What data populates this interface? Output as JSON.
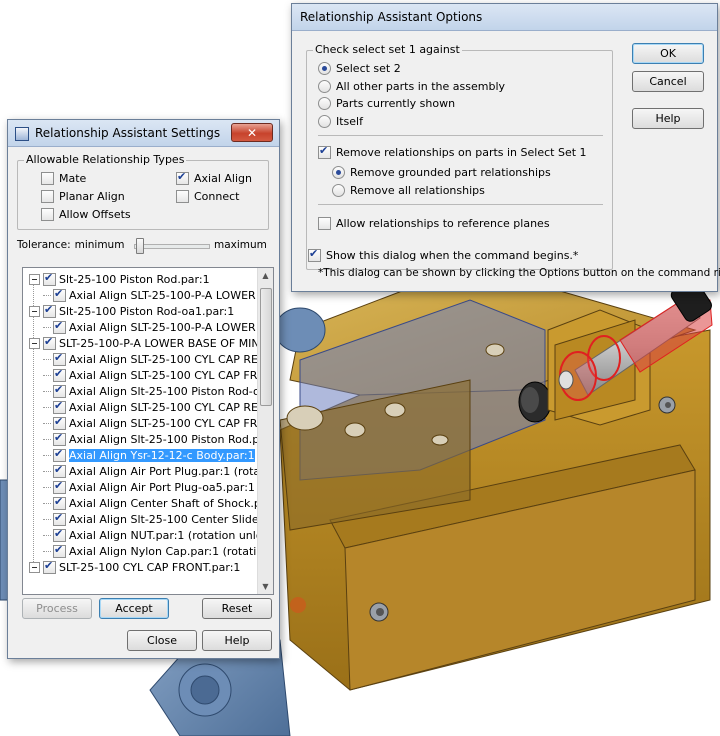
{
  "settings_dialog": {
    "title": "Relationship Assistant Settings",
    "close_glyph": "✕",
    "types_group_label": "Allowable Relationship Types",
    "types": [
      {
        "label": "Mate",
        "checked": false
      },
      {
        "label": "Axial Align",
        "checked": true
      },
      {
        "label": "Planar Align",
        "checked": false
      },
      {
        "label": "Connect",
        "checked": false
      },
      {
        "label": "Allow Offsets",
        "checked": false
      }
    ],
    "tolerance_label": "Tolerance:",
    "tolerance_min": "minimum",
    "tolerance_max": "maximum",
    "tree": [
      {
        "level": 0,
        "text": "Slt-25-100 Piston Rod.par:1",
        "checked": true
      },
      {
        "level": 1,
        "text": "Axial Align SLT-25-100-P-A LOWER",
        "checked": true
      },
      {
        "level": 0,
        "text": "Slt-25-100 Piston Rod-oa1.par:1",
        "checked": true
      },
      {
        "level": 1,
        "text": "Axial Align SLT-25-100-P-A LOWER",
        "checked": true
      },
      {
        "level": 0,
        "text": "SLT-25-100-P-A LOWER BASE OF MIN",
        "checked": true
      },
      {
        "level": 1,
        "text": "Axial Align SLT-25-100 CYL CAP RE",
        "checked": true
      },
      {
        "level": 1,
        "text": "Axial Align SLT-25-100 CYL CAP FR",
        "checked": true
      },
      {
        "level": 1,
        "text": "Axial Align Slt-25-100 Piston Rod-oa1",
        "checked": true
      },
      {
        "level": 1,
        "text": "Axial Align SLT-25-100 CYL CAP RE",
        "checked": true
      },
      {
        "level": 1,
        "text": "Axial Align SLT-25-100 CYL CAP FR",
        "checked": true
      },
      {
        "level": 1,
        "text": "Axial Align Slt-25-100 Piston Rod.par",
        "checked": true
      },
      {
        "level": 1,
        "text": "Axial Align Ysr-12-12-c Body.par:1",
        "checked": true,
        "selected": true
      },
      {
        "level": 1,
        "text": "Axial Align Air Port Plug.par:1   (rotat",
        "checked": true
      },
      {
        "level": 1,
        "text": "Axial Align Air Port Plug-oa5.par:1   (",
        "checked": true
      },
      {
        "level": 1,
        "text": "Axial Align Center Shaft of Shock.pa",
        "checked": true
      },
      {
        "level": 1,
        "text": "Axial Align Slt-25-100 Center Slide.pa",
        "checked": true
      },
      {
        "level": 1,
        "text": "Axial Align NUT.par:1   (rotation unlo",
        "checked": true
      },
      {
        "level": 1,
        "text": "Axial Align Nylon Cap.par:1   (rotatio",
        "checked": true
      },
      {
        "level": 0,
        "text": "SLT-25-100 CYL CAP FRONT.par:1",
        "checked": true
      }
    ],
    "buttons": {
      "process": "Process",
      "accept": "Accept",
      "reset": "Reset",
      "close": "Close",
      "help": "Help"
    }
  },
  "options_dialog": {
    "title": "Relationship Assistant Options",
    "group_label": "Check select set 1 against",
    "against": [
      {
        "label": "Select set 2",
        "selected": true
      },
      {
        "label": "All other parts in the assembly",
        "selected": false
      },
      {
        "label": "Parts currently shown",
        "selected": false
      },
      {
        "label": "Itself",
        "selected": false
      }
    ],
    "remove_label": "Remove relationships on parts in Select Set 1",
    "remove_checked": true,
    "remove_options": [
      {
        "label": "Remove grounded part relationships",
        "selected": true
      },
      {
        "label": "Remove all relationships",
        "selected": false
      }
    ],
    "allow_ref_label": "Allow relationships to reference planes",
    "allow_ref_checked": false,
    "show_dialog_label": "Show this dialog when the command begins.*",
    "show_dialog_checked": true,
    "footnote": "*This dialog can be shown by clicking the Options button on the command ribbon.",
    "buttons": {
      "ok": "OK",
      "cancel": "Cancel",
      "help": "Help"
    }
  },
  "colors": {
    "brass": "#c89b30",
    "steel_blue": "#5a7ba8",
    "red_accent": "#e02020",
    "selection": "#3399ff"
  }
}
